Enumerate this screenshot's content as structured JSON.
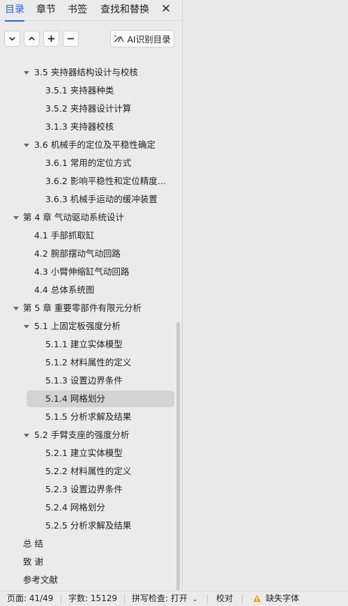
{
  "tabs": [
    "目录",
    "章节",
    "书签",
    "查找和替换"
  ],
  "ai_button_label": "AI识别目录",
  "toc": [
    {
      "label": "3.5  夹持器结构设计与校核",
      "level": 1,
      "arrow": true
    },
    {
      "label": "3.5.1  夹持器种类",
      "level": 2
    },
    {
      "label": "3.5.2  夹持器设计计算",
      "level": 2
    },
    {
      "label": "3.1.3  夹持器校核",
      "level": 2
    },
    {
      "label": "3.6 机械手的定位及平稳性确定",
      "level": 1,
      "arrow": true
    },
    {
      "label": "3.6.1 常用的定位方式",
      "level": 2
    },
    {
      "label": "3.6.2 影响平稳性和定位精度的 ...",
      "level": 2
    },
    {
      "label": "3.6.3 机械手运动的缓冲装置",
      "level": 2
    },
    {
      "label": "第 4 章    气动驱动系统设计",
      "level": 0,
      "arrow": true
    },
    {
      "label": "4.1  手部抓取缸",
      "level": 1
    },
    {
      "label": "4.2  腕部摆动气动回路",
      "level": 1
    },
    {
      "label": "4.3  小臂伸缩缸气动回路",
      "level": 1
    },
    {
      "label": "4.4  总体系统图",
      "level": 1
    },
    {
      "label": "第 5 章    重要零部件有限元分析",
      "level": 0,
      "arrow": true
    },
    {
      "label": "5.1  上固定板强度分析",
      "level": 1,
      "arrow": true
    },
    {
      "label": "5.1.1  建立实体模型",
      "level": 2
    },
    {
      "label": "5.1.2  材料属性的定义",
      "level": 2
    },
    {
      "label": "5.1.3  设置边界条件",
      "level": 2
    },
    {
      "label": "5.1.4  网格划分",
      "level": 2,
      "selected": true
    },
    {
      "label": "5.1.5  分析求解及结果",
      "level": 2
    },
    {
      "label": "5.2  手臂支座的强度分析",
      "level": 1,
      "arrow": true
    },
    {
      "label": "5.2.1  建立实体模型",
      "level": 2
    },
    {
      "label": "5.2.2  材料属性的定义",
      "level": 2
    },
    {
      "label": "5.2.3  设置边界条件",
      "level": 2
    },
    {
      "label": "5.2.4  网格划分",
      "level": 2
    },
    {
      "label": "5.2.5  分析求解及结果",
      "level": 2
    },
    {
      "label": "总    结",
      "level": 0
    },
    {
      "label": "致    谢",
      "level": 0
    },
    {
      "label": "参考文献",
      "level": 0
    }
  ],
  "status": {
    "page": "页面: 41/49",
    "words": "字数: 15129",
    "spell": "拼写检查: 打开",
    "proof": "校对",
    "missing_font": "缺失字体"
  },
  "colors": {
    "accent": "#2a63d4",
    "warning": "#e8a317",
    "selected_bg": "#d3d3d3"
  }
}
